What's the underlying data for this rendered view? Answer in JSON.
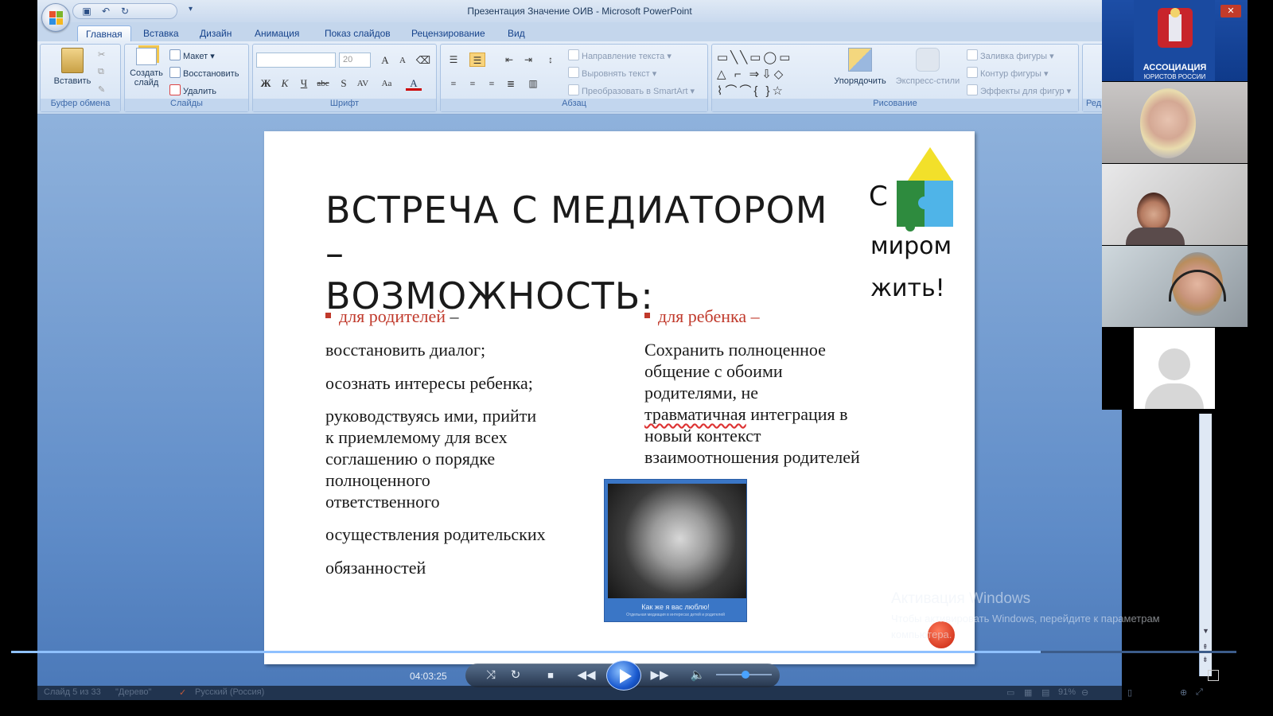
{
  "window": {
    "title": "Презентация Значение ОИВ - Microsoft PowerPoint"
  },
  "tabs": [
    {
      "label": "Главная",
      "active": true
    },
    {
      "label": "Вставка"
    },
    {
      "label": "Дизайн"
    },
    {
      "label": "Анимация"
    },
    {
      "label": "Показ слайдов"
    },
    {
      "label": "Рецензирование"
    },
    {
      "label": "Вид"
    }
  ],
  "ribbon": {
    "clipboard": {
      "paste": "Вставить",
      "group": "Буфер обмена"
    },
    "slides": {
      "new_slide": "Создать слайд",
      "layout": "Макет",
      "reset": "Восстановить",
      "delete": "Удалить",
      "group": "Слайды"
    },
    "font": {
      "font_name": "",
      "font_size": "20",
      "group": "Шрифт"
    },
    "paragraph": {
      "text_direction": "Направление текста",
      "align_text": "Выровнять текст",
      "smartart": "Преобразовать в SmartArt",
      "group": "Абзац"
    },
    "drawing": {
      "arrange": "Упорядочить",
      "quick_styles": "Экспресс-стили",
      "shape_fill": "Заливка фигуры",
      "shape_outline": "Контур фигуры",
      "shape_effects": "Эффекты для фигур",
      "group": "Рисование"
    },
    "editing": {
      "group": "Ред"
    }
  },
  "slide": {
    "title_line1": "ВСТРЕЧА С МЕДИАТОРОМ –",
    "title_line2": "ВОЗМОЖНОСТЬ:",
    "left_head": "для родителей",
    "left_dash": "–",
    "left_items": [
      "восстановить диалог;",
      "осознать интересы ребенка;",
      "руководствуясь ими, прийти",
      "к приемлемому для всех",
      "соглашению о порядке",
      "полноценного",
      "ответственного",
      "осуществления родительских",
      "обязанностей"
    ],
    "right_head": "для ребенка",
    "right_dash": "–",
    "right_lines": [
      "Сохранить полноценное",
      "общение с обоими",
      "родителями,  не",
      "травматичная",
      " интеграция в",
      "новый контекст",
      "взаимоотношения родителей"
    ],
    "logo": {
      "l1": "С",
      "l2": "миром",
      "l3": "жить!"
    },
    "photo_caption": "Как же я вас люблю!",
    "photo_subcaption": "Отдельная медиация в интересах детей и родителей"
  },
  "activation": {
    "heading": "Активация Windows",
    "text1": "Чтобы активировать Windows, перейдите к параметрам",
    "text2": "компьютера."
  },
  "player": {
    "time": "04:03:25",
    "progress": 0.84,
    "volume": 0.45
  },
  "status": {
    "slide": "Слайд 5 из 33",
    "theme": "\"Дерево\"",
    "lang": "Русский (Россия)",
    "zoom": "91%"
  },
  "call": {
    "emblem_line1": "АССОЦИАЦИЯ",
    "emblem_line2": "ЮРИСТОВ РОССИИ"
  },
  "colors": {
    "accent_red": "#c0392b",
    "slide_bg": "#ffffff",
    "workspace": "#6a94cc"
  }
}
